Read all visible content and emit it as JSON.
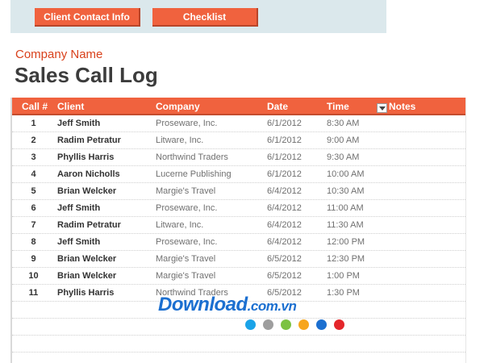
{
  "nav": {
    "buttons": [
      {
        "label": "Client Contact Info"
      },
      {
        "label": "Checklist"
      }
    ]
  },
  "header": {
    "company_name": "Company Name",
    "title": "Sales Call Log"
  },
  "table": {
    "columns": [
      "Call #",
      "Client",
      "Company",
      "Date",
      "Time",
      "Notes"
    ],
    "filter_icon": "dropdown-arrow-icon",
    "rows": [
      {
        "num": "1",
        "client": "Jeff Smith",
        "company": "Proseware, Inc.",
        "date": "6/1/2012",
        "time": "8:30 AM"
      },
      {
        "num": "2",
        "client": "Radim Petratur",
        "company": "Litware, Inc.",
        "date": "6/1/2012",
        "time": "9:00 AM"
      },
      {
        "num": "3",
        "client": "Phyllis Harris",
        "company": "Northwind Traders",
        "date": "6/1/2012",
        "time": "9:30 AM"
      },
      {
        "num": "4",
        "client": "Aaron Nicholls",
        "company": "Lucerne Publishing",
        "date": "6/1/2012",
        "time": "10:00 AM"
      },
      {
        "num": "5",
        "client": "Brian Welcker",
        "company": "Margie's Travel",
        "date": "6/4/2012",
        "time": "10:30 AM"
      },
      {
        "num": "6",
        "client": "Jeff Smith",
        "company": "Proseware, Inc.",
        "date": "6/4/2012",
        "time": "11:00 AM"
      },
      {
        "num": "7",
        "client": "Radim Petratur",
        "company": "Litware, Inc.",
        "date": "6/4/2012",
        "time": "11:30 AM"
      },
      {
        "num": "8",
        "client": "Jeff Smith",
        "company": "Proseware, Inc.",
        "date": "6/4/2012",
        "time": "12:00 PM"
      },
      {
        "num": "9",
        "client": "Brian Welcker",
        "company": "Margie's Travel",
        "date": "6/5/2012",
        "time": "12:30 PM"
      },
      {
        "num": "10",
        "client": "Brian Welcker",
        "company": "Margie's Travel",
        "date": "6/5/2012",
        "time": "1:00 PM"
      },
      {
        "num": "11",
        "client": "Phyllis Harris",
        "company": "Northwind Traders",
        "date": "6/5/2012",
        "time": "1:30 PM"
      }
    ]
  },
  "watermark": {
    "text": "Download",
    "suffix": ".com.vn",
    "dot_colors": [
      "#1aa3e8",
      "#9e9e9e",
      "#7cc242",
      "#f7a51c",
      "#1b6fd0",
      "#e4262b"
    ]
  },
  "colors": {
    "accent": "#f0623e",
    "nav_band": "#dbe8ec",
    "company_name": "#d9411b"
  }
}
